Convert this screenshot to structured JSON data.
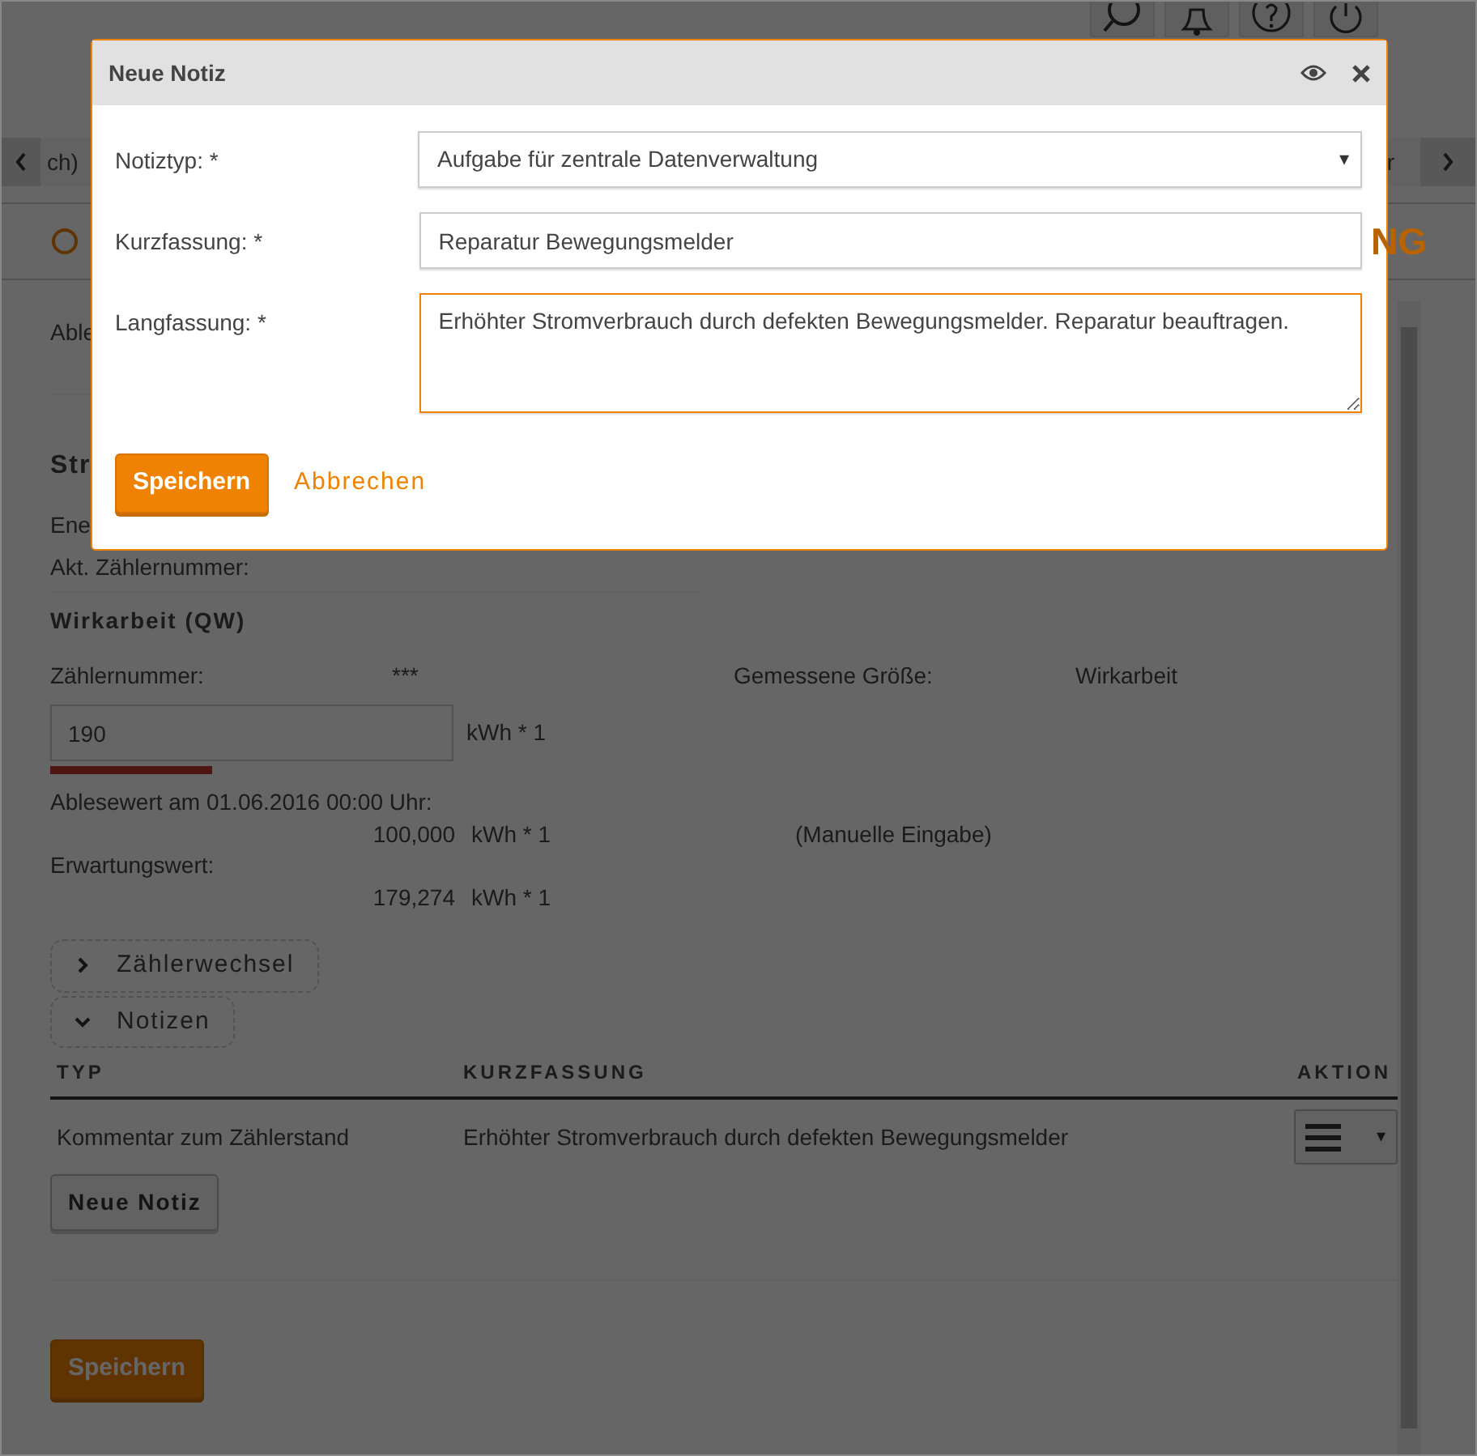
{
  "tab_strip": {
    "left_fragment": "ch)",
    "right_fragment": "r"
  },
  "page_heading": {
    "fragment": "NG"
  },
  "page": {
    "reading_fragment": "Able",
    "section_fragment": "Str",
    "energy_fragment": "Ene",
    "meter_number_label": "Akt. Zählernummer:",
    "register": {
      "title": "Wirkarbeit (QW)",
      "meter_label": "Zählernummer:",
      "meter_value": "***",
      "measured_label": "Gemessene Größe:",
      "measured_value": "Wirkarbeit",
      "input_value": "190",
      "input_unit": "kWh * 1",
      "reading_label": "Ablesewert am 01.06.2016 00:00 Uhr:",
      "reading_value": "100,000",
      "reading_unit": "kWh * 1",
      "reading_source": "(Manuelle Eingabe)",
      "expected_label": "Erwartungswert:",
      "expected_value": "179,274",
      "expected_unit": "kWh * 1"
    },
    "expanders": [
      {
        "label": "Zählerwechsel",
        "expanded": false
      },
      {
        "label": "Notizen",
        "expanded": true
      }
    ],
    "notes_table": {
      "columns": [
        "TYP",
        "KURZFASSUNG",
        "AKTION"
      ],
      "rows": [
        {
          "type": "Kommentar zum Zählerstand",
          "summary": "Erhöhter Stromverbrauch durch defekten Bewegungsmelder",
          "action_caret": "▾"
        }
      ]
    },
    "new_note_button": "Neue Notiz",
    "save_button": "Speichern"
  },
  "modal": {
    "title": "Neue Notiz",
    "fields": [
      {
        "kind": "select",
        "label": "Notiztyp: *",
        "value": "Aufgabe für zentrale Datenverwaltung",
        "caret": "▾",
        "focused": false
      },
      {
        "kind": "input",
        "label": "Kurzfassung: *",
        "value": "Reparatur Bewegungsmelder",
        "focused": false
      },
      {
        "kind": "textarea",
        "label": "Langfassung: *",
        "value": "Erhöhter Stromverbrauch durch defekten Bewegungsmelder. Reparatur beauftragen.",
        "focused": true
      }
    ],
    "save_button": "Speichern",
    "cancel_link": "Abbrechen"
  }
}
